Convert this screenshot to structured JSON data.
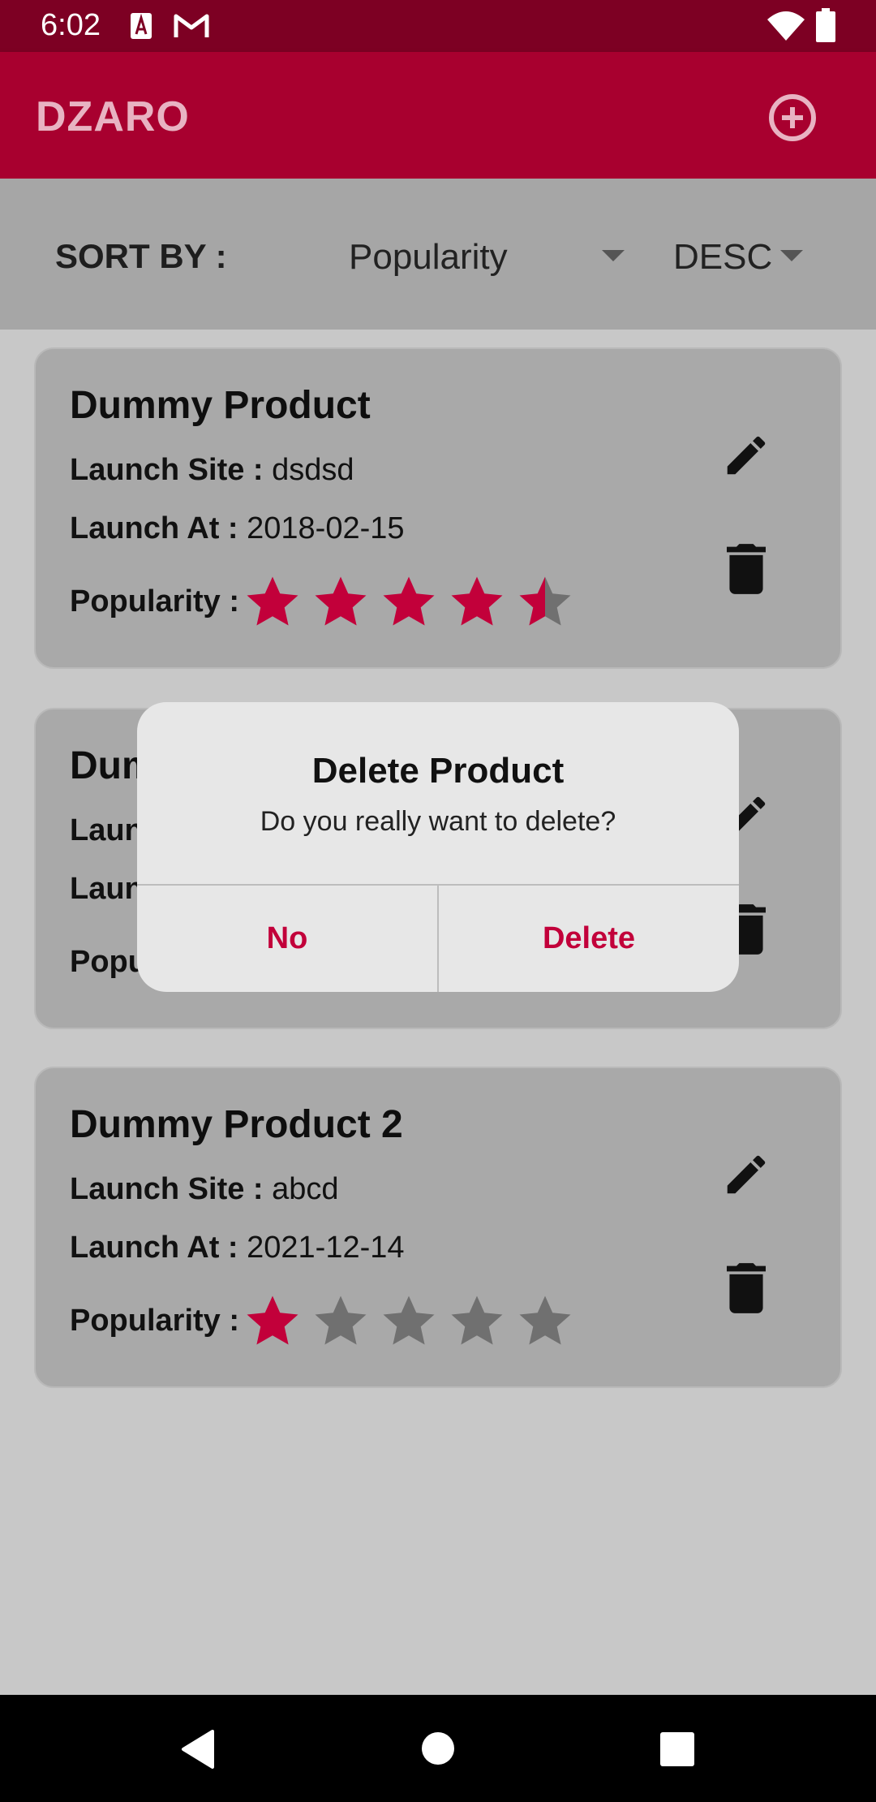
{
  "status_bar": {
    "time": "6:02"
  },
  "app_bar": {
    "title": "DZARO"
  },
  "sort": {
    "label": "SORT BY :",
    "field_value": "Popularity",
    "order_value": "DESC"
  },
  "products": [
    {
      "name": "Dummy Product",
      "launch_site_label": "Launch Site :",
      "launch_site": "dsdsd",
      "launch_at_label": "Launch At :",
      "launch_at": "2018-02-15",
      "popularity_label": "Popularity :",
      "rating": 4.5,
      "max_rating": 5
    },
    {
      "name": "Dum",
      "launch_site_label": "Laun",
      "launch_site": "",
      "launch_at_label": "Laun",
      "launch_at": "",
      "popularity_label": "Popu",
      "rating": null,
      "max_rating": 5
    },
    {
      "name": "Dummy Product 2",
      "launch_site_label": "Launch Site :",
      "launch_site": "abcd",
      "launch_at_label": "Launch At :",
      "launch_at": "2021-12-14",
      "popularity_label": "Popularity :",
      "rating": 1,
      "max_rating": 5
    }
  ],
  "dialog": {
    "title": "Delete Product",
    "message": "Do you really want to delete?",
    "cancel_label": "No",
    "confirm_label": "Delete"
  },
  "colors": {
    "accent": "#c2003a",
    "app_bar": "#a8002f",
    "status_bar": "#7d0023",
    "star_filled": "#c2003a",
    "star_empty": "#707070"
  },
  "icons": {
    "add": "plus-circle-icon",
    "edit": "pencil-icon",
    "delete": "trash-icon",
    "sort_dropdown": "caret-down-icon",
    "nav_back": "back-triangle-icon",
    "nav_home": "home-circle-icon",
    "nav_recents": "recents-square-icon"
  }
}
